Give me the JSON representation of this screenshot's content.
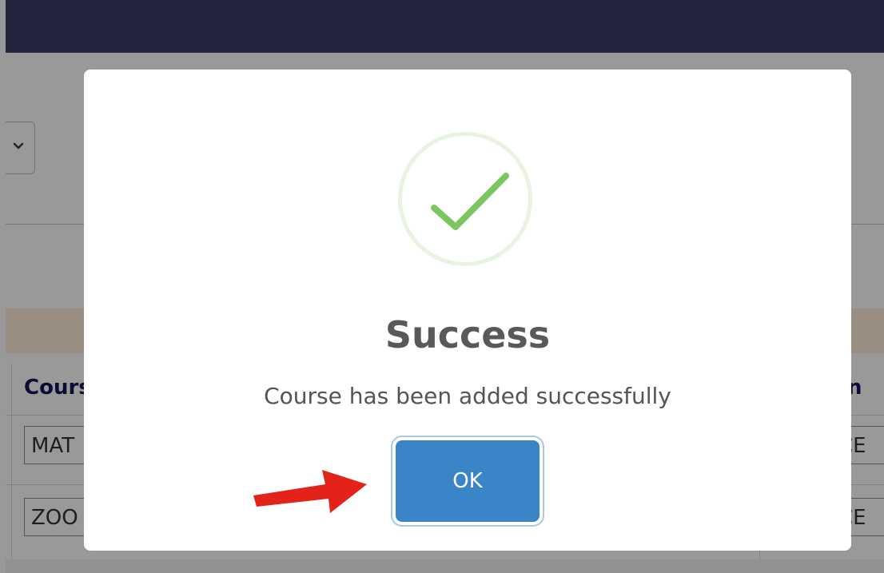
{
  "background": {
    "table_header": {
      "col1": "Cours",
      "col_right": "n"
    },
    "rows": [
      {
        "left_value": "MAT",
        "right_value": "CE"
      },
      {
        "left_value": "ZOO",
        "right_value": "CE"
      }
    ]
  },
  "dialog": {
    "icon": "success-check-icon",
    "title": "Success",
    "message": "Course has been added successfully",
    "ok_label": "OK"
  },
  "annotation": {
    "icon": "red-arrow-icon",
    "color": "#e32219"
  },
  "colors": {
    "header": "#3d3d66",
    "ok_button": "#3a84c8",
    "check": "#7cc661",
    "title_text": "#595959"
  }
}
